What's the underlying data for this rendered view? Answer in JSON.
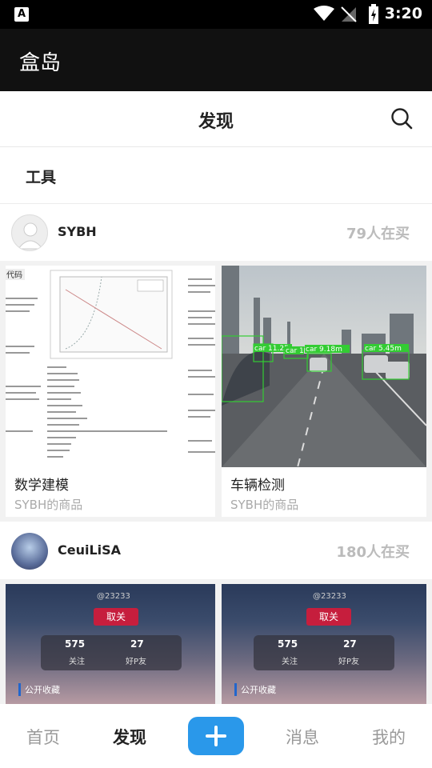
{
  "status": {
    "time": "3:20",
    "notif_glyph": "A"
  },
  "app": {
    "title": "盒岛"
  },
  "header": {
    "title": "发现",
    "search_icon": "search-icon"
  },
  "tools": {
    "label": "工具"
  },
  "sections": [
    {
      "seller": "SYBH",
      "buyers": "79人在买",
      "products": [
        {
          "title": "数学建模",
          "subtitle": "SYBH的商品"
        },
        {
          "title": "车辆检测",
          "subtitle": "SYBH的商品"
        }
      ]
    },
    {
      "seller": "CeuiLiSA",
      "buyers": "180人在买",
      "products": [
        {
          "title": "",
          "subtitle": "",
          "btn": "取关",
          "s1": "575",
          "s1_label": "关注",
          "s2": "27",
          "s2_label": "好P友",
          "pub": "公开收藏",
          "id": "@23233"
        },
        {
          "title": "",
          "subtitle": "",
          "btn": "取关",
          "s1": "575",
          "s1_label": "关注",
          "s2": "27",
          "s2_label": "好P友",
          "pub": "公开收藏",
          "id": "@23233"
        }
      ]
    }
  ],
  "detection_labels": [
    "car 11.25m",
    "car 1",
    "car 9.18m",
    "car 5.45m"
  ],
  "nav": {
    "home": "首页",
    "discover": "发现",
    "messages": "消息",
    "mine": "我的"
  },
  "colors": {
    "accent": "#2a98ea",
    "unfollow": "#c61e3d"
  }
}
